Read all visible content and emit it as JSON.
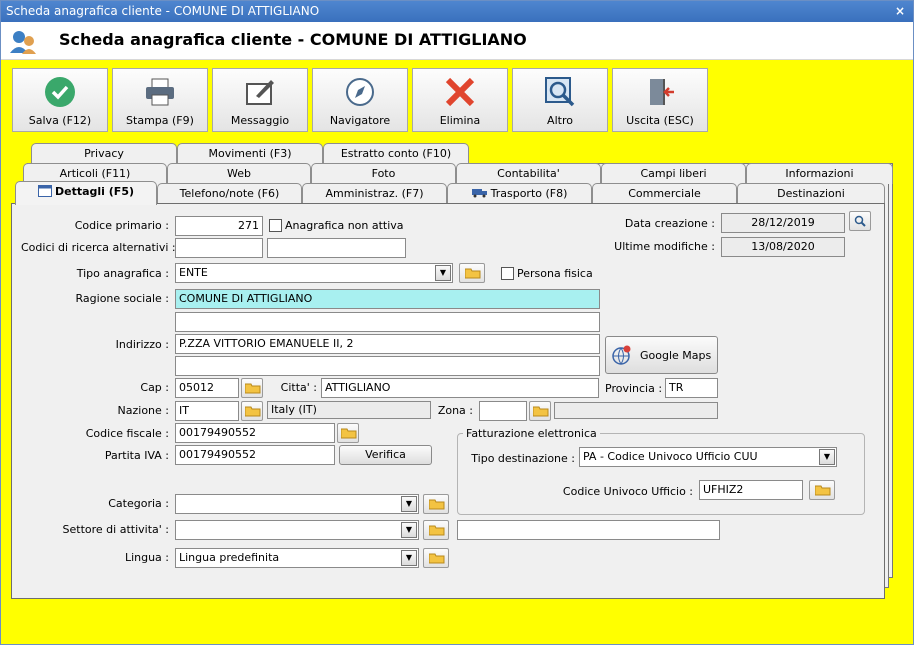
{
  "window": {
    "title": "Scheda anagrafica cliente - COMUNE DI ATTIGLIANO",
    "close": "×"
  },
  "header": {
    "title": "Scheda anagrafica cliente - COMUNE DI ATTIGLIANO"
  },
  "toolbar": {
    "save": "Salva (F12)",
    "print": "Stampa (F9)",
    "message": "Messaggio",
    "navigator": "Navigatore",
    "delete": "Elimina",
    "other": "Altro",
    "exit": "Uscita (ESC)"
  },
  "tabs": {
    "row1": [
      "Privacy",
      "Movimenti (F3)",
      "Estratto conto (F10)"
    ],
    "row2": [
      "Articoli (F11)",
      "Web",
      "Foto",
      "Contabilita'",
      "Campi liberi",
      "Informazioni"
    ],
    "row3": [
      "Dettagli (F5)",
      "Telefono/note (F6)",
      "Amministraz. (F7)",
      "Trasporto (F8)",
      "Commerciale",
      "Destinazioni"
    ]
  },
  "form": {
    "codice_primario_label": "Codice primario :",
    "codice_primario": "271",
    "anagrafica_non_attiva": "Anagrafica non attiva",
    "codici_ricerca_label": "Codici di ricerca alternativi :",
    "data_creazione_label": "Data creazione :",
    "data_creazione": "28/12/2019",
    "ultime_modifiche_label": "Ultime modifiche :",
    "ultime_modifiche": "13/08/2020",
    "tipo_anagrafica_label": "Tipo anagrafica :",
    "tipo_anagrafica": "ENTE",
    "persona_fisica": "Persona fisica",
    "ragione_sociale_label": "Ragione sociale :",
    "ragione_sociale": "COMUNE DI ATTIGLIANO",
    "indirizzo_label": "Indirizzo :",
    "indirizzo": "P.ZZA VITTORIO EMANUELE II, 2",
    "google_maps": "Google Maps",
    "cap_label": "Cap :",
    "cap": "05012",
    "citta_label": "Citta' :",
    "citta": "ATTIGLIANO",
    "provincia_label": "Provincia :",
    "provincia": "TR",
    "nazione_label": "Nazione :",
    "nazione": "IT",
    "nazione_desc": "Italy (IT)",
    "zona_label": "Zona :",
    "codice_fiscale_label": "Codice fiscale :",
    "codice_fiscale": "00179490552",
    "partita_iva_label": "Partita IVA :",
    "partita_iva": "00179490552",
    "verifica": "Verifica",
    "fatturazione_legend": "Fatturazione elettronica",
    "tipo_destinazione_label": "Tipo destinazione :",
    "tipo_destinazione": "PA - Codice Univoco Ufficio CUU",
    "codice_univoco_label": "Codice Univoco Ufficio :",
    "codice_univoco": "UFHIZ2",
    "categoria_label": "Categoria :",
    "settore_label": "Settore di attivita' :",
    "lingua_label": "Lingua :",
    "lingua": "Lingua predefinita"
  }
}
